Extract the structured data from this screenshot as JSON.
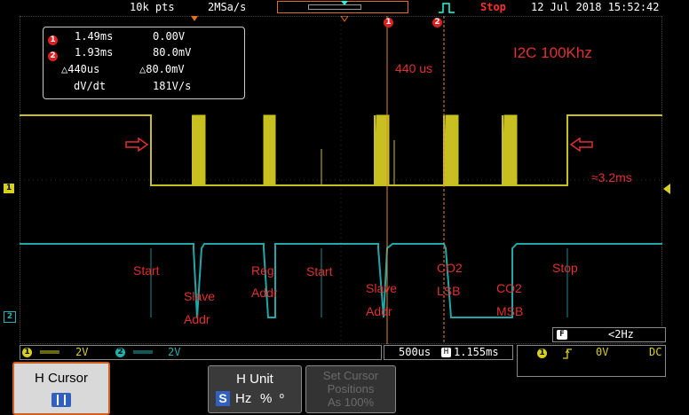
{
  "top_bar": {
    "points": "10k pts",
    "sample_rate": "2MSa/s",
    "status": "Stop",
    "datetime": "12 Jul 2018 15:52:42"
  },
  "cursor_readout": {
    "c1_time": "1.49ms",
    "c1_volt": "0.00V",
    "c2_time": "1.93ms",
    "c2_volt": "80.0mV",
    "delta_time": "△440us",
    "delta_volt": "△80.0mV",
    "dvdt_label": "dV/dt",
    "dvdt_value": "181V/s",
    "cursor1_marker": "1",
    "cursor2_marker": "2"
  },
  "annotations": {
    "title": "I2C 100Khz",
    "delta": "440 us",
    "duration": "≈3.2ms",
    "start1": "Start",
    "slave1": "Slave",
    "addr1": "Addr",
    "reg": "Reg",
    "addr_reg": "Addr",
    "start2": "Start",
    "slave2": "Slave",
    "addr2": "Addr",
    "co2_lsb_1": "CO2",
    "co2_lsb_2": "LSB",
    "co2_msb_1": "CO2",
    "co2_msb_2": "MSB",
    "stop": "Stop"
  },
  "channels": {
    "ch1_marker": "1",
    "ch2_marker": "2",
    "ch1_scale": "2V",
    "ch2_scale": "2V",
    "ch1_color": "#d8d020",
    "ch2_color": "#20b0b0"
  },
  "timebase": {
    "scale": "500us",
    "position_icon": "H",
    "position": "1.155ms"
  },
  "trigger": {
    "freq_icon": "F",
    "freq": "<2Hz",
    "source": "1",
    "slope_icon": "rising-edge",
    "level": "0V",
    "coupling": "DC"
  },
  "menu": {
    "h_cursor": "H Cursor",
    "h_unit": "H Unit",
    "h_unit_s": "S",
    "h_unit_hz": "Hz",
    "h_unit_pct": "%",
    "h_unit_deg": "º",
    "set_cursor_1": "Set Cursor",
    "set_cursor_2": "Positions",
    "set_cursor_3": "As 100%"
  }
}
